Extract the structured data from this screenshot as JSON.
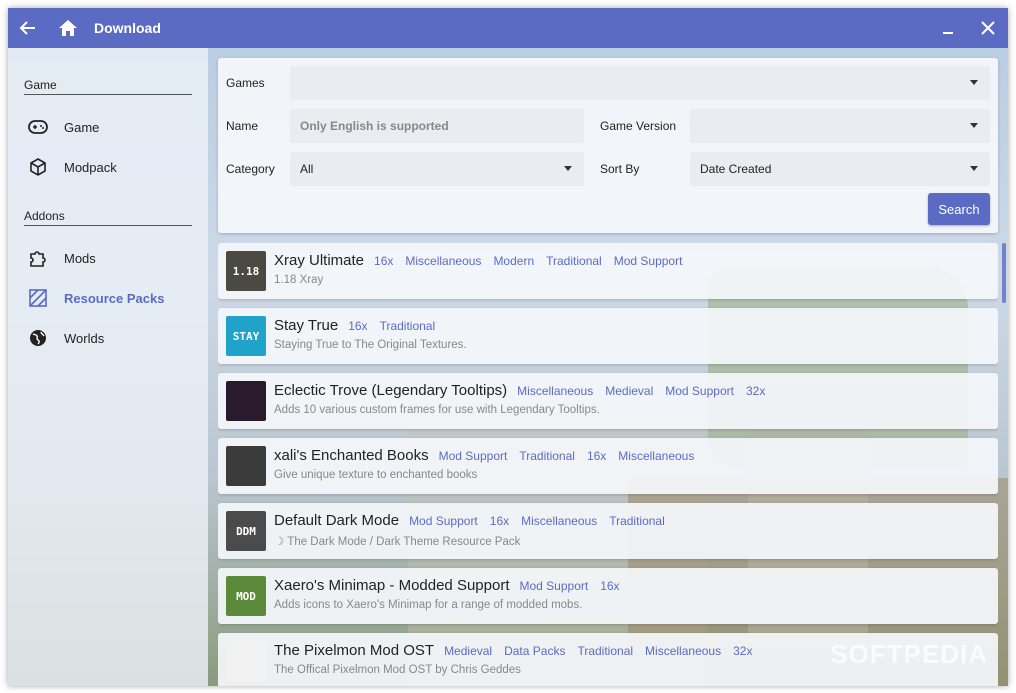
{
  "titlebar": {
    "title": "Download"
  },
  "sidebar": {
    "section_game": "Game",
    "game_items": [
      {
        "label": "Game",
        "icon": "gamepad-icon"
      },
      {
        "label": "Modpack",
        "icon": "cube-icon"
      }
    ],
    "section_addons": "Addons",
    "addon_items": [
      {
        "label": "Mods",
        "icon": "puzzle-icon"
      },
      {
        "label": "Resource Packs",
        "icon": "texture-icon",
        "active": true
      },
      {
        "label": "Worlds",
        "icon": "globe-icon"
      }
    ]
  },
  "filters": {
    "games_label": "Games",
    "games_value": "",
    "name_label": "Name",
    "name_placeholder": "Only English is supported",
    "version_label": "Game Version",
    "version_value": "",
    "category_label": "Category",
    "category_value": "All",
    "sort_label": "Sort By",
    "sort_value": "Date Created",
    "search_label": "Search"
  },
  "results": [
    {
      "name": "Xray Ultimate",
      "tags": [
        "16x",
        "Miscellaneous",
        "Modern",
        "Traditional",
        "Mod Support"
      ],
      "desc": "1.18 Xray",
      "thumb_text": "1.18",
      "thumb_color": "#4a4a42"
    },
    {
      "name": "Stay True",
      "tags": [
        "16x",
        "Traditional"
      ],
      "desc": "Staying True to The Original Textures.",
      "thumb_text": "STAY",
      "thumb_color": "#1fa3c8"
    },
    {
      "name": "Eclectic Trove (Legendary Tooltips)",
      "tags": [
        "Miscellaneous",
        "Medieval",
        "Mod Support",
        "32x"
      ],
      "desc": "Adds 10 various custom frames for use with Legendary Tooltips.",
      "thumb_text": "",
      "thumb_color": "#2a1a2e"
    },
    {
      "name": "xali's Enchanted Books",
      "tags": [
        "Mod Support",
        "Traditional",
        "16x",
        "Miscellaneous"
      ],
      "desc": "Give unique texture to enchanted books",
      "thumb_text": "",
      "thumb_color": "#3b3b3b"
    },
    {
      "name": "Default Dark Mode",
      "tags": [
        "Mod Support",
        "16x",
        "Miscellaneous",
        "Traditional"
      ],
      "desc": "☽ The Dark Mode / Dark Theme Resource Pack",
      "thumb_text": "DDM",
      "thumb_color": "#4b4b4b"
    },
    {
      "name": "Xaero's Minimap - Modded Support",
      "tags": [
        "Mod Support",
        "16x"
      ],
      "desc": "Adds icons to Xaero's Minimap for a range of modded mobs.",
      "thumb_text": "MOD",
      "thumb_color": "#5a8a3a"
    },
    {
      "name": "The Pixelmon Mod OST",
      "tags": [
        "Medieval",
        "Data Packs",
        "Traditional",
        "Miscellaneous",
        "32x"
      ],
      "desc": "The Offical Pixelmon Mod OST by Chris Geddes",
      "thumb_text": "",
      "thumb_color": "#f2f2f2"
    }
  ],
  "watermark": "SOFTPEDIA",
  "colors": {
    "accent": "#5b6bc4"
  }
}
